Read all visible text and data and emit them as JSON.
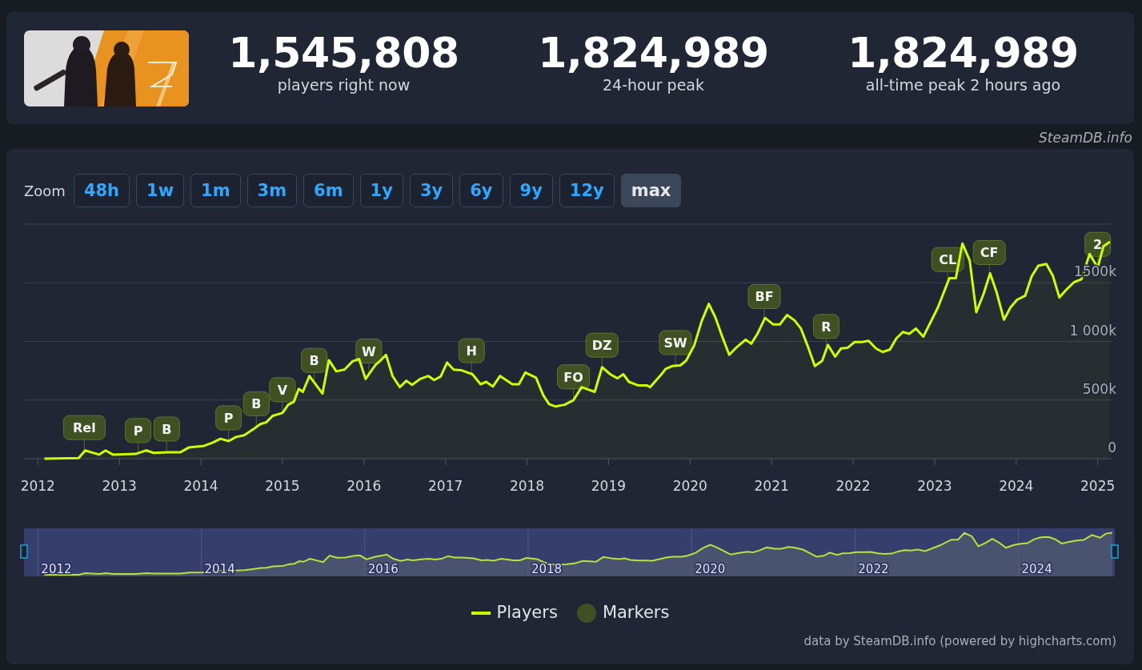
{
  "stats": [
    {
      "value": "1,545,808",
      "label": "players right now"
    },
    {
      "value": "1,824,989",
      "label": "24-hour peak"
    },
    {
      "value": "1,824,989",
      "label": "all-time peak 2 hours ago"
    }
  ],
  "source": "SteamDB.info",
  "zoom": {
    "label": "Zoom",
    "buttons": [
      {
        "label": "48h",
        "selected": false
      },
      {
        "label": "1w",
        "selected": false
      },
      {
        "label": "1m",
        "selected": false
      },
      {
        "label": "3m",
        "selected": false
      },
      {
        "label": "6m",
        "selected": false
      },
      {
        "label": "1y",
        "selected": false
      },
      {
        "label": "3y",
        "selected": false
      },
      {
        "label": "6y",
        "selected": false
      },
      {
        "label": "9y",
        "selected": false
      },
      {
        "label": "12y",
        "selected": false
      },
      {
        "label": "max",
        "selected": true
      }
    ]
  },
  "chart_data": {
    "type": "line",
    "x": [
      2012.08,
      2012.5,
      2012.58,
      2012.75,
      2012.83,
      2012.92,
      2013.2,
      2013.33,
      2013.42,
      2013.6,
      2013.75,
      2013.85,
      2014.04,
      2014.14,
      2014.24,
      2014.34,
      2014.43,
      2014.53,
      2014.63,
      2014.73,
      2014.8,
      2014.88,
      2015.0,
      2015.07,
      2015.14,
      2015.2,
      2015.25,
      2015.33,
      2015.49,
      2015.57,
      2015.66,
      2015.76,
      2015.86,
      2015.94,
      2016.02,
      2016.14,
      2016.2,
      2016.27,
      2016.35,
      2016.44,
      2016.52,
      2016.59,
      2016.69,
      2016.79,
      2016.86,
      2016.94,
      2017.02,
      2017.1,
      2017.19,
      2017.33,
      2017.43,
      2017.5,
      2017.58,
      2017.67,
      2017.82,
      2017.9,
      2017.98,
      2018.11,
      2018.2,
      2018.27,
      2018.35,
      2018.46,
      2018.57,
      2018.67,
      2018.83,
      2018.92,
      2019.02,
      2019.11,
      2019.18,
      2019.25,
      2019.36,
      2019.47,
      2019.51,
      2019.65,
      2019.7,
      2019.78,
      2019.88,
      2019.95,
      2020.05,
      2020.14,
      2020.23,
      2020.31,
      2020.39,
      2020.48,
      2020.57,
      2020.68,
      2020.75,
      2020.83,
      2020.92,
      2021.02,
      2021.1,
      2021.19,
      2021.28,
      2021.36,
      2021.44,
      2021.53,
      2021.62,
      2021.69,
      2021.78,
      2021.85,
      2021.93,
      2022.02,
      2022.11,
      2022.19,
      2022.28,
      2022.36,
      2022.45,
      2022.53,
      2022.61,
      2022.69,
      2022.77,
      2022.86,
      2022.94,
      2023.04,
      2023.18,
      2023.26,
      2023.34,
      2023.43,
      2023.51,
      2023.6,
      2023.68,
      2023.76,
      2023.85,
      2023.93,
      2024.01,
      2024.11,
      2024.19,
      2024.27,
      2024.37,
      2024.45,
      2024.53,
      2024.62,
      2024.71,
      2024.8,
      2024.9,
      2025.0,
      2025.07,
      2025.15
    ],
    "series": [
      {
        "name": "Players",
        "color": "#ccff00",
        "values": [
          0,
          5,
          70,
          35,
          70,
          35,
          40,
          70,
          50,
          55,
          55,
          95,
          110,
          135,
          170,
          150,
          185,
          200,
          245,
          295,
          310,
          365,
          390,
          460,
          485,
          595,
          570,
          705,
          555,
          840,
          745,
          760,
          830,
          850,
          680,
          800,
          835,
          885,
          705,
          610,
          665,
          630,
          680,
          705,
          670,
          700,
          820,
          760,
          755,
          720,
          635,
          655,
          615,
          705,
          635,
          635,
          735,
          690,
          540,
          465,
          445,
          460,
          500,
          610,
          570,
          780,
          720,
          685,
          720,
          655,
          625,
          625,
          610,
          720,
          765,
          790,
          795,
          835,
          965,
          1170,
          1320,
          1205,
          1050,
          885,
          950,
          1015,
          980,
          1070,
          1200,
          1145,
          1145,
          1225,
          1180,
          1110,
          965,
          790,
          835,
          970,
          870,
          940,
          945,
          995,
          995,
          1005,
          940,
          910,
          930,
          1025,
          1080,
          1065,
          1110,
          1040,
          1150,
          1290,
          1540,
          1540,
          1835,
          1690,
          1250,
          1405,
          1580,
          1420,
          1185,
          1290,
          1355,
          1390,
          1555,
          1645,
          1660,
          1560,
          1375,
          1445,
          1505,
          1530,
          1745,
          1630,
          1810,
          1850
        ]
      }
    ],
    "xlim": [
      2011.83,
      2025.18
    ],
    "ylim": [
      0,
      2000
    ],
    "xticks": [
      2012,
      2013,
      2014,
      2015,
      2016,
      2017,
      2018,
      2019,
      2020,
      2021,
      2022,
      2023,
      2024,
      2025
    ],
    "yticks": [
      {
        "value": 0,
        "label": "0"
      },
      {
        "value": 500,
        "label": "500k"
      },
      {
        "value": 1000,
        "label": "1 000k"
      },
      {
        "value": 1500,
        "label": "1500k"
      }
    ],
    "grid": true,
    "annotations": [
      {
        "x": 2012.57,
        "y": 67,
        "text": "Rel"
      },
      {
        "x": 2013.23,
        "y": 42,
        "text": "P"
      },
      {
        "x": 2013.58,
        "y": 55,
        "text": "B"
      },
      {
        "x": 2014.34,
        "y": 150,
        "text": "P"
      },
      {
        "x": 2014.68,
        "y": 270,
        "text": "B"
      },
      {
        "x": 2015.0,
        "y": 390,
        "text": "V"
      },
      {
        "x": 2015.39,
        "y": 640,
        "text": "B"
      },
      {
        "x": 2016.06,
        "y": 720,
        "text": "W"
      },
      {
        "x": 2017.32,
        "y": 723,
        "text": "H"
      },
      {
        "x": 2018.57,
        "y": 500,
        "text": "FO"
      },
      {
        "x": 2018.92,
        "y": 770,
        "text": "DZ"
      },
      {
        "x": 2019.82,
        "y": 792,
        "text": "SW"
      },
      {
        "x": 2020.91,
        "y": 1185,
        "text": "BF"
      },
      {
        "x": 2021.67,
        "y": 930,
        "text": "R"
      },
      {
        "x": 2023.16,
        "y": 1500,
        "text": "CL"
      },
      {
        "x": 2023.67,
        "y": 1560,
        "text": "CF"
      },
      {
        "x": 2025.0,
        "y": 1630,
        "text": "2"
      }
    ]
  },
  "navigator": {
    "labels": [
      "2012",
      "2014",
      "2016",
      "2018",
      "2020",
      "2022",
      "2024"
    ]
  },
  "legend": [
    {
      "kind": "series"
    },
    {
      "label": "Markers",
      "kind": "marker"
    }
  ],
  "credits": "data by SteamDB.info (powered by highcharts.com)"
}
